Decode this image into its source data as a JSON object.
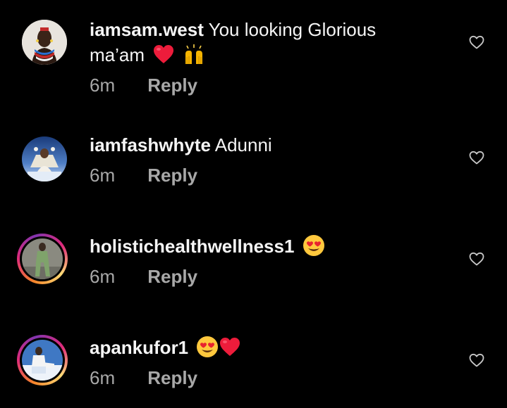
{
  "comments": [
    {
      "username": "iamsam.west",
      "text_line1": "You looking Glorious",
      "text_line2": "ma’am",
      "time": "6m",
      "reply_label": "Reply"
    },
    {
      "username": "iamfashwhyte",
      "text": "Adunni",
      "time": "6m",
      "reply_label": "Reply"
    },
    {
      "username": "holistichealthwellness1",
      "time": "6m",
      "reply_label": "Reply"
    },
    {
      "username": "apankufor1",
      "time": "6m",
      "reply_label": "Reply"
    }
  ],
  "icons": {
    "like": "heart-outline-icon",
    "red_heart": "red-heart-emoji",
    "raised_hands": "raising-hands-emoji",
    "heart_eyes": "heart-eyes-emoji"
  },
  "colors": {
    "background": "#000000",
    "primary_text": "#f5f5f5",
    "secondary_text": "#a8a8a8",
    "heart_red": "#ed1c3b",
    "story_ring": "#dd2a7b"
  }
}
